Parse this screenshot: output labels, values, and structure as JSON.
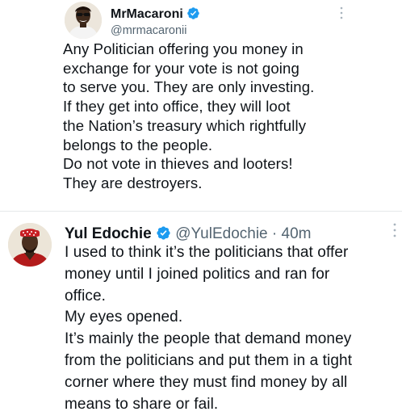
{
  "tweets": [
    {
      "display_name": "MrMacaroni",
      "handle": "@mrmacaronii",
      "time": "",
      "text": "Any Politician offering you money in\nexchange for your vote is not going\nto serve you. They are only investing.\nIf they get into office, they will loot\nthe Nation’s treasury which rightfully\nbelongs to the people.\nDo not vote in thieves and looters!\nThey are destroyers."
    },
    {
      "display_name": "Yul Edochie",
      "handle": "@YulEdochie",
      "separator": "·",
      "time": "40m",
      "text": "I used to think it’s the politicians that offer\nmoney until I joined politics and ran for\noffice.\nMy eyes opened.\nIt’s mainly the people that demand money\nfrom the politicians and put them in a tight\ncorner where they must find money by all\nmeans to share or fail."
    }
  ],
  "icons": {
    "verified": "verified-badge-icon",
    "more": "more-vertical-icon"
  },
  "colors": {
    "verified_blue": "#1d9bf0",
    "text": "#0f1419",
    "secondary_text": "#536471",
    "divider": "#e6e8ea"
  }
}
